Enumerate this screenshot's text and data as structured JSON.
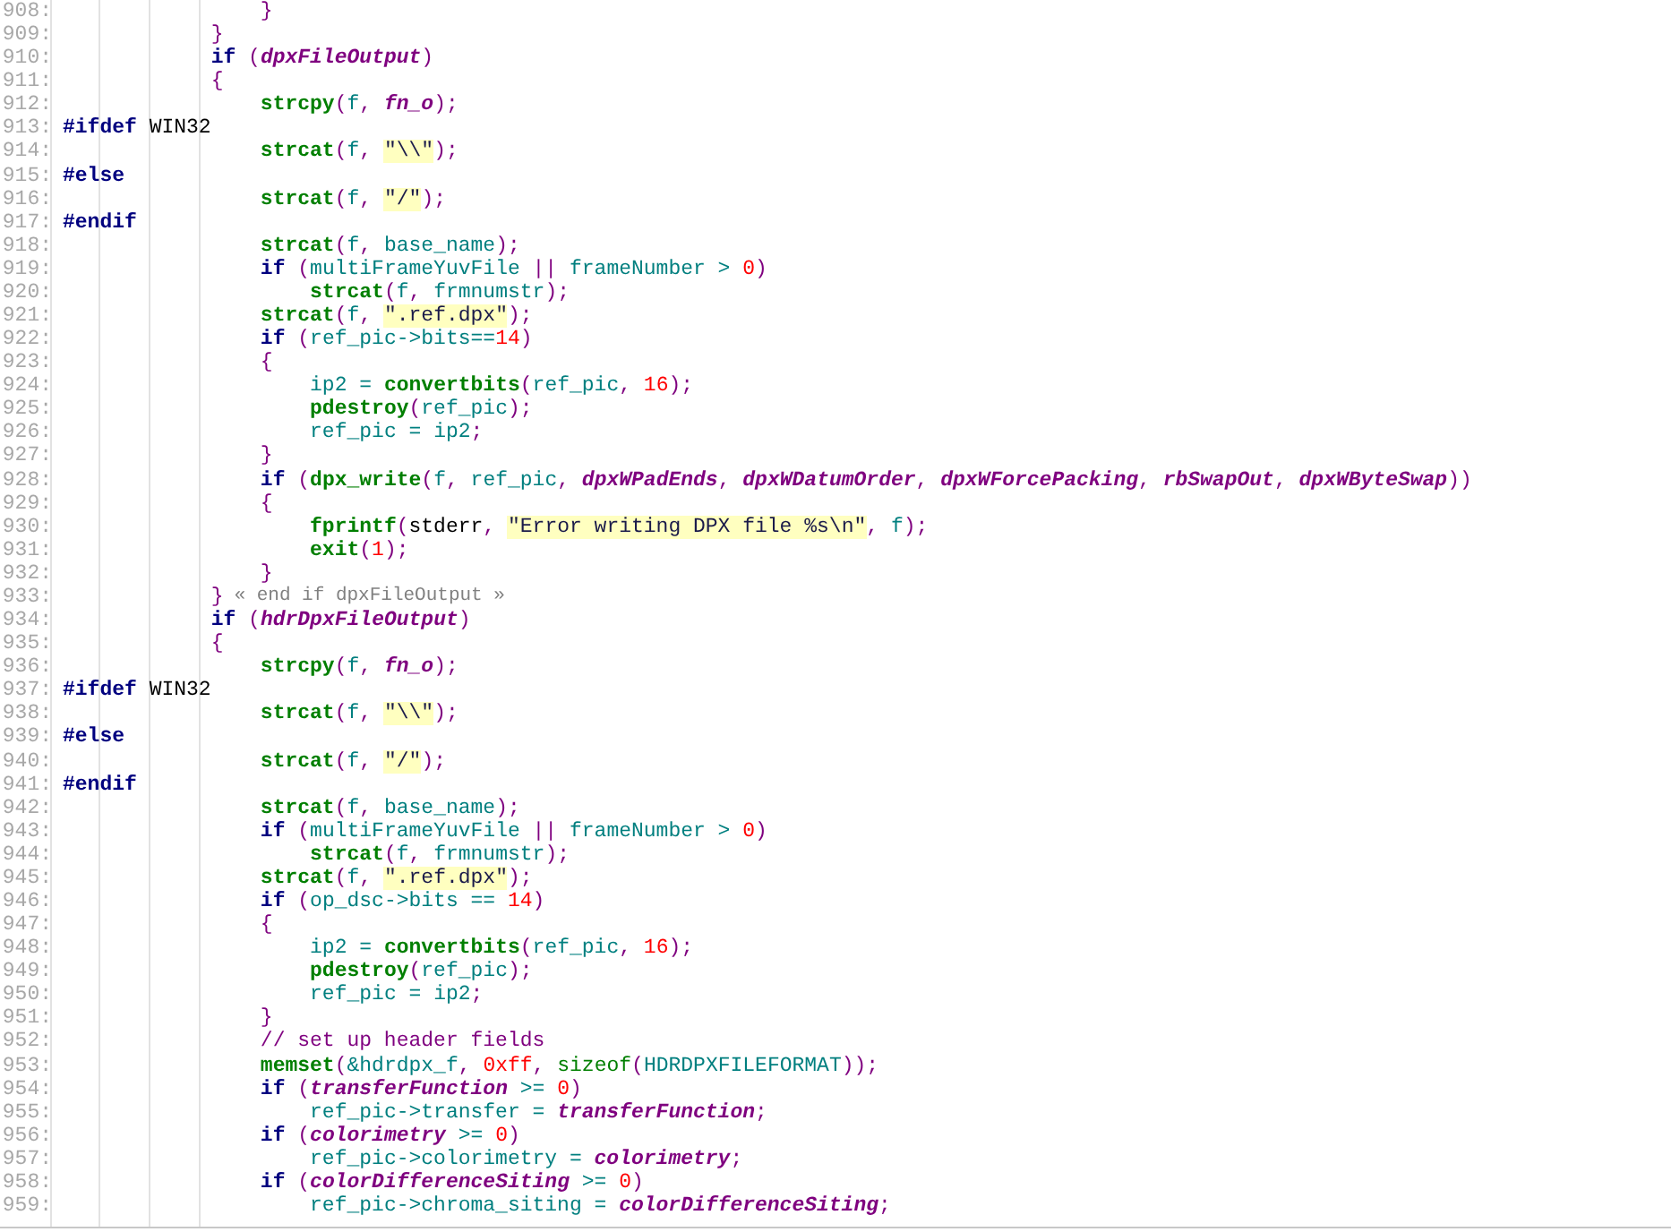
{
  "editor": {
    "lines": [
      {
        "number": "908:",
        "tokens": [
          {
            "kind": "punct",
            "text": "                }"
          }
        ]
      },
      {
        "number": "909:",
        "tokens": [
          {
            "kind": "punct",
            "text": "            }"
          }
        ]
      },
      {
        "number": "910:",
        "tokens": [
          {
            "kind": "keyword",
            "text": "            if"
          },
          {
            "kind": "punct",
            "text": " ("
          },
          {
            "kind": "param",
            "text": "dpxFileOutput"
          },
          {
            "kind": "punct",
            "text": ")"
          }
        ]
      },
      {
        "number": "911:",
        "tokens": [
          {
            "kind": "punct",
            "text": "            {"
          }
        ]
      },
      {
        "number": "912:",
        "tokens": [
          {
            "kind": "function",
            "text": "                strcpy"
          },
          {
            "kind": "punct",
            "text": "("
          },
          {
            "kind": "ident",
            "text": "f"
          },
          {
            "kind": "punct",
            "text": ", "
          },
          {
            "kind": "param",
            "text": "fn_o"
          },
          {
            "kind": "punct",
            "text": ");"
          }
        ]
      },
      {
        "number": "913:",
        "tokens": [
          {
            "kind": "preproc",
            "text": "#ifdef"
          },
          {
            "kind": "plain",
            "text": " WIN32"
          }
        ]
      },
      {
        "number": "914:",
        "tokens": [
          {
            "kind": "function",
            "text": "                strcat"
          },
          {
            "kind": "punct",
            "text": "("
          },
          {
            "kind": "ident",
            "text": "f"
          },
          {
            "kind": "punct",
            "text": ", "
          },
          {
            "kind": "string",
            "text": "\"\\\\\""
          },
          {
            "kind": "punct",
            "text": ");"
          }
        ]
      },
      {
        "number": "915:",
        "tokens": [
          {
            "kind": "preproc",
            "text": "#else"
          }
        ]
      },
      {
        "number": "916:",
        "tokens": [
          {
            "kind": "function",
            "text": "                strcat"
          },
          {
            "kind": "punct",
            "text": "("
          },
          {
            "kind": "ident",
            "text": "f"
          },
          {
            "kind": "punct",
            "text": ", "
          },
          {
            "kind": "string",
            "text": "\"/\""
          },
          {
            "kind": "punct",
            "text": ");"
          }
        ]
      },
      {
        "number": "917:",
        "tokens": [
          {
            "kind": "preproc",
            "text": "#endif"
          }
        ]
      },
      {
        "number": "918:",
        "tokens": [
          {
            "kind": "function",
            "text": "                strcat"
          },
          {
            "kind": "punct",
            "text": "("
          },
          {
            "kind": "ident",
            "text": "f"
          },
          {
            "kind": "punct",
            "text": ", "
          },
          {
            "kind": "ident",
            "text": "base_name"
          },
          {
            "kind": "punct",
            "text": ");"
          }
        ]
      },
      {
        "number": "919:",
        "tokens": [
          {
            "kind": "keyword",
            "text": "                if"
          },
          {
            "kind": "punct",
            "text": " ("
          },
          {
            "kind": "ident",
            "text": "multiFrameYuvFile"
          },
          {
            "kind": "punct",
            "text": " || "
          },
          {
            "kind": "ident",
            "text": "frameNumber"
          },
          {
            "kind": "operator",
            "text": " > "
          },
          {
            "kind": "number",
            "text": "0"
          },
          {
            "kind": "punct",
            "text": ")"
          }
        ]
      },
      {
        "number": "920:",
        "tokens": [
          {
            "kind": "function",
            "text": "                    strcat"
          },
          {
            "kind": "punct",
            "text": "("
          },
          {
            "kind": "ident",
            "text": "f"
          },
          {
            "kind": "punct",
            "text": ", "
          },
          {
            "kind": "ident",
            "text": "frmnumstr"
          },
          {
            "kind": "punct",
            "text": ");"
          }
        ]
      },
      {
        "number": "921:",
        "tokens": [
          {
            "kind": "function",
            "text": "                strcat"
          },
          {
            "kind": "punct",
            "text": "("
          },
          {
            "kind": "ident",
            "text": "f"
          },
          {
            "kind": "punct",
            "text": ", "
          },
          {
            "kind": "string",
            "text": "\".ref.dpx\""
          },
          {
            "kind": "punct",
            "text": ");"
          }
        ]
      },
      {
        "number": "922:",
        "tokens": [
          {
            "kind": "keyword",
            "text": "                if"
          },
          {
            "kind": "punct",
            "text": " ("
          },
          {
            "kind": "ident",
            "text": "ref_pic->bits"
          },
          {
            "kind": "operator",
            "text": "=="
          },
          {
            "kind": "number",
            "text": "14"
          },
          {
            "kind": "punct",
            "text": ")"
          }
        ]
      },
      {
        "number": "923:",
        "tokens": [
          {
            "kind": "punct",
            "text": "                {"
          }
        ]
      },
      {
        "number": "924:",
        "tokens": [
          {
            "kind": "ident",
            "text": "                    ip2"
          },
          {
            "kind": "operator",
            "text": " = "
          },
          {
            "kind": "function",
            "text": "convertbits"
          },
          {
            "kind": "punct",
            "text": "("
          },
          {
            "kind": "ident",
            "text": "ref_pic"
          },
          {
            "kind": "punct",
            "text": ", "
          },
          {
            "kind": "number",
            "text": "16"
          },
          {
            "kind": "punct",
            "text": ");"
          }
        ]
      },
      {
        "number": "925:",
        "tokens": [
          {
            "kind": "function",
            "text": "                    pdestroy"
          },
          {
            "kind": "punct",
            "text": "("
          },
          {
            "kind": "ident",
            "text": "ref_pic"
          },
          {
            "kind": "punct",
            "text": ");"
          }
        ]
      },
      {
        "number": "926:",
        "tokens": [
          {
            "kind": "ident",
            "text": "                    ref_pic"
          },
          {
            "kind": "operator",
            "text": " = "
          },
          {
            "kind": "ident",
            "text": "ip2"
          },
          {
            "kind": "punct",
            "text": ";"
          }
        ]
      },
      {
        "number": "927:",
        "tokens": [
          {
            "kind": "punct",
            "text": "                }"
          }
        ]
      },
      {
        "number": "928:",
        "tokens": [
          {
            "kind": "keyword",
            "text": "                if"
          },
          {
            "kind": "punct",
            "text": " ("
          },
          {
            "kind": "function",
            "text": "dpx_write"
          },
          {
            "kind": "punct",
            "text": "("
          },
          {
            "kind": "ident",
            "text": "f"
          },
          {
            "kind": "punct",
            "text": ", "
          },
          {
            "kind": "ident",
            "text": "ref_pic"
          },
          {
            "kind": "punct",
            "text": ", "
          },
          {
            "kind": "param",
            "text": "dpxWPadEnds"
          },
          {
            "kind": "punct",
            "text": ", "
          },
          {
            "kind": "param",
            "text": "dpxWDatumOrder"
          },
          {
            "kind": "punct",
            "text": ", "
          },
          {
            "kind": "param",
            "text": "dpxWForcePacking"
          },
          {
            "kind": "punct",
            "text": ", "
          },
          {
            "kind": "param",
            "text": "rbSwapOut"
          },
          {
            "kind": "punct",
            "text": ", "
          },
          {
            "kind": "param",
            "text": "dpxWByteSwap"
          },
          {
            "kind": "punct",
            "text": "))"
          }
        ]
      },
      {
        "number": "929:",
        "tokens": [
          {
            "kind": "punct",
            "text": "                {"
          }
        ]
      },
      {
        "number": "930:",
        "tokens": [
          {
            "kind": "function",
            "text": "                    fprintf"
          },
          {
            "kind": "punct",
            "text": "("
          },
          {
            "kind": "plain",
            "text": "stderr"
          },
          {
            "kind": "punct",
            "text": ", "
          },
          {
            "kind": "string",
            "text": "\"Error writing DPX file %s\\n\""
          },
          {
            "kind": "punct",
            "text": ", "
          },
          {
            "kind": "ident",
            "text": "f"
          },
          {
            "kind": "punct",
            "text": ");"
          }
        ]
      },
      {
        "number": "931:",
        "tokens": [
          {
            "kind": "function",
            "text": "                    exit"
          },
          {
            "kind": "punct",
            "text": "("
          },
          {
            "kind": "number",
            "text": "1"
          },
          {
            "kind": "punct",
            "text": ");"
          }
        ]
      },
      {
        "number": "932:",
        "tokens": [
          {
            "kind": "punct",
            "text": "                }"
          }
        ]
      },
      {
        "number": "933:",
        "tokens": [
          {
            "kind": "punct",
            "text": "            }"
          },
          {
            "kind": "note",
            "text": "« end if dpxFileOutput »"
          }
        ]
      },
      {
        "number": "934:",
        "tokens": [
          {
            "kind": "keyword",
            "text": "            if"
          },
          {
            "kind": "punct",
            "text": " ("
          },
          {
            "kind": "param",
            "text": "hdrDpxFileOutput"
          },
          {
            "kind": "punct",
            "text": ")"
          }
        ]
      },
      {
        "number": "935:",
        "tokens": [
          {
            "kind": "punct",
            "text": "            {"
          }
        ]
      },
      {
        "number": "936:",
        "tokens": [
          {
            "kind": "function",
            "text": "                strcpy"
          },
          {
            "kind": "punct",
            "text": "("
          },
          {
            "kind": "ident",
            "text": "f"
          },
          {
            "kind": "punct",
            "text": ", "
          },
          {
            "kind": "param",
            "text": "fn_o"
          },
          {
            "kind": "punct",
            "text": ");"
          }
        ]
      },
      {
        "number": "937:",
        "tokens": [
          {
            "kind": "preproc",
            "text": "#ifdef"
          },
          {
            "kind": "plain",
            "text": " WIN32"
          }
        ]
      },
      {
        "number": "938:",
        "tokens": [
          {
            "kind": "function",
            "text": "                strcat"
          },
          {
            "kind": "punct",
            "text": "("
          },
          {
            "kind": "ident",
            "text": "f"
          },
          {
            "kind": "punct",
            "text": ", "
          },
          {
            "kind": "string",
            "text": "\"\\\\\""
          },
          {
            "kind": "punct",
            "text": ");"
          }
        ]
      },
      {
        "number": "939:",
        "tokens": [
          {
            "kind": "preproc",
            "text": "#else"
          }
        ]
      },
      {
        "number": "940:",
        "tokens": [
          {
            "kind": "function",
            "text": "                strcat"
          },
          {
            "kind": "punct",
            "text": "("
          },
          {
            "kind": "ident",
            "text": "f"
          },
          {
            "kind": "punct",
            "text": ", "
          },
          {
            "kind": "string",
            "text": "\"/\""
          },
          {
            "kind": "punct",
            "text": ");"
          }
        ]
      },
      {
        "number": "941:",
        "tokens": [
          {
            "kind": "preproc",
            "text": "#endif"
          }
        ]
      },
      {
        "number": "942:",
        "tokens": [
          {
            "kind": "function",
            "text": "                strcat"
          },
          {
            "kind": "punct",
            "text": "("
          },
          {
            "kind": "ident",
            "text": "f"
          },
          {
            "kind": "punct",
            "text": ", "
          },
          {
            "kind": "ident",
            "text": "base_name"
          },
          {
            "kind": "punct",
            "text": ");"
          }
        ]
      },
      {
        "number": "943:",
        "tokens": [
          {
            "kind": "keyword",
            "text": "                if"
          },
          {
            "kind": "punct",
            "text": " ("
          },
          {
            "kind": "ident",
            "text": "multiFrameYuvFile"
          },
          {
            "kind": "punct",
            "text": " || "
          },
          {
            "kind": "ident",
            "text": "frameNumber"
          },
          {
            "kind": "operator",
            "text": " > "
          },
          {
            "kind": "number",
            "text": "0"
          },
          {
            "kind": "punct",
            "text": ")"
          }
        ]
      },
      {
        "number": "944:",
        "tokens": [
          {
            "kind": "function",
            "text": "                    strcat"
          },
          {
            "kind": "punct",
            "text": "("
          },
          {
            "kind": "ident",
            "text": "f"
          },
          {
            "kind": "punct",
            "text": ", "
          },
          {
            "kind": "ident",
            "text": "frmnumstr"
          },
          {
            "kind": "punct",
            "text": ");"
          }
        ]
      },
      {
        "number": "945:",
        "tokens": [
          {
            "kind": "function",
            "text": "                strcat"
          },
          {
            "kind": "punct",
            "text": "("
          },
          {
            "kind": "ident",
            "text": "f"
          },
          {
            "kind": "punct",
            "text": ", "
          },
          {
            "kind": "string",
            "text": "\".ref.dpx\""
          },
          {
            "kind": "punct",
            "text": ");"
          }
        ]
      },
      {
        "number": "946:",
        "tokens": [
          {
            "kind": "keyword",
            "text": "                if"
          },
          {
            "kind": "punct",
            "text": " ("
          },
          {
            "kind": "ident",
            "text": "op_dsc->bits"
          },
          {
            "kind": "operator",
            "text": " == "
          },
          {
            "kind": "number",
            "text": "14"
          },
          {
            "kind": "punct",
            "text": ")"
          }
        ]
      },
      {
        "number": "947:",
        "tokens": [
          {
            "kind": "punct",
            "text": "                {"
          }
        ]
      },
      {
        "number": "948:",
        "tokens": [
          {
            "kind": "ident",
            "text": "                    ip2"
          },
          {
            "kind": "operator",
            "text": " = "
          },
          {
            "kind": "function",
            "text": "convertbits"
          },
          {
            "kind": "punct",
            "text": "("
          },
          {
            "kind": "ident",
            "text": "ref_pic"
          },
          {
            "kind": "punct",
            "text": ", "
          },
          {
            "kind": "number",
            "text": "16"
          },
          {
            "kind": "punct",
            "text": ");"
          }
        ]
      },
      {
        "number": "949:",
        "tokens": [
          {
            "kind": "function",
            "text": "                    pdestroy"
          },
          {
            "kind": "punct",
            "text": "("
          },
          {
            "kind": "ident",
            "text": "ref_pic"
          },
          {
            "kind": "punct",
            "text": ");"
          }
        ]
      },
      {
        "number": "950:",
        "tokens": [
          {
            "kind": "ident",
            "text": "                    ref_pic"
          },
          {
            "kind": "operator",
            "text": " = "
          },
          {
            "kind": "ident",
            "text": "ip2"
          },
          {
            "kind": "punct",
            "text": ";"
          }
        ]
      },
      {
        "number": "951:",
        "tokens": [
          {
            "kind": "punct",
            "text": "                }"
          }
        ]
      },
      {
        "number": "952:",
        "tokens": [
          {
            "kind": "comment",
            "text": "                // set up header fields"
          }
        ]
      },
      {
        "number": "953:",
        "tokens": [
          {
            "kind": "function",
            "text": "                memset"
          },
          {
            "kind": "punct",
            "text": "("
          },
          {
            "kind": "ident",
            "text": "&hdrdpx_f"
          },
          {
            "kind": "punct",
            "text": ", "
          },
          {
            "kind": "number",
            "text": "0xff"
          },
          {
            "kind": "punct",
            "text": ", "
          },
          {
            "kind": "builtin",
            "text": "sizeof"
          },
          {
            "kind": "punct",
            "text": "("
          },
          {
            "kind": "ident",
            "text": "HDRDPXFILEFORMAT"
          },
          {
            "kind": "punct",
            "text": "));"
          }
        ]
      },
      {
        "number": "954:",
        "tokens": [
          {
            "kind": "keyword",
            "text": "                if"
          },
          {
            "kind": "punct",
            "text": " ("
          },
          {
            "kind": "param",
            "text": "transferFunction"
          },
          {
            "kind": "operator",
            "text": " >= "
          },
          {
            "kind": "number",
            "text": "0"
          },
          {
            "kind": "punct",
            "text": ")"
          }
        ]
      },
      {
        "number": "955:",
        "tokens": [
          {
            "kind": "ident",
            "text": "                    ref_pic->transfer"
          },
          {
            "kind": "operator",
            "text": " = "
          },
          {
            "kind": "param",
            "text": "transferFunction"
          },
          {
            "kind": "punct",
            "text": ";"
          }
        ]
      },
      {
        "number": "956:",
        "tokens": [
          {
            "kind": "keyword",
            "text": "                if"
          },
          {
            "kind": "punct",
            "text": " ("
          },
          {
            "kind": "param",
            "text": "colorimetry"
          },
          {
            "kind": "operator",
            "text": " >= "
          },
          {
            "kind": "number",
            "text": "0"
          },
          {
            "kind": "punct",
            "text": ")"
          }
        ]
      },
      {
        "number": "957:",
        "tokens": [
          {
            "kind": "ident",
            "text": "                    ref_pic->colorimetry"
          },
          {
            "kind": "operator",
            "text": " = "
          },
          {
            "kind": "param",
            "text": "colorimetry"
          },
          {
            "kind": "punct",
            "text": ";"
          }
        ]
      },
      {
        "number": "958:",
        "tokens": [
          {
            "kind": "keyword",
            "text": "                if"
          },
          {
            "kind": "punct",
            "text": " ("
          },
          {
            "kind": "param",
            "text": "colorDifferenceSiting"
          },
          {
            "kind": "operator",
            "text": " >= "
          },
          {
            "kind": "number",
            "text": "0"
          },
          {
            "kind": "punct",
            "text": ")"
          }
        ]
      },
      {
        "number": "959:",
        "tokens": [
          {
            "kind": "ident",
            "text": "                    ref_pic->chroma_siting"
          },
          {
            "kind": "operator",
            "text": " = "
          },
          {
            "kind": "param",
            "text": "colorDifferenceSiting"
          },
          {
            "kind": "punct",
            "text": ";"
          }
        ]
      }
    ]
  }
}
